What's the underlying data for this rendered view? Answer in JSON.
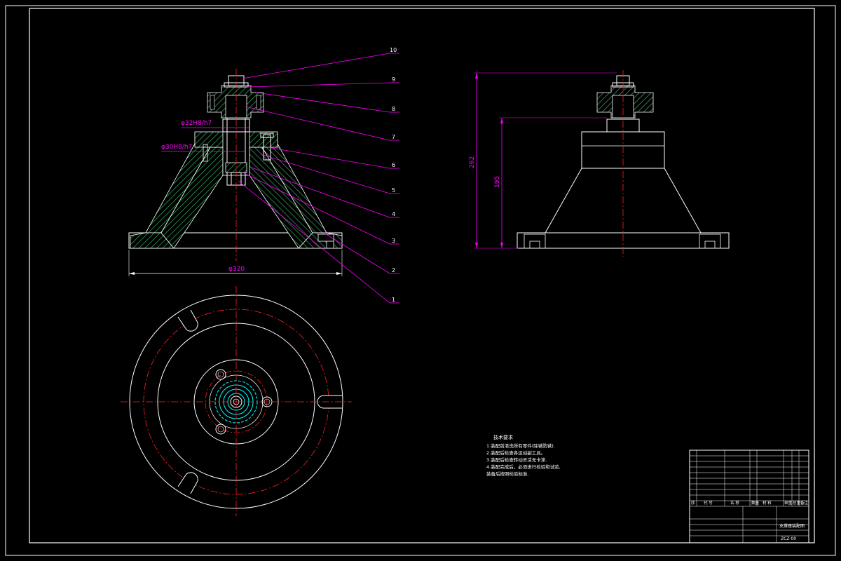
{
  "colors": {
    "background": "#000000",
    "line": "#ffffff",
    "hatch": "#2e8b57",
    "dimension": "#ff00ff",
    "centerline": "#ff2020",
    "cyan": "#00ffff",
    "label": "#ffffff"
  },
  "callouts": [
    "10",
    "9",
    "8",
    "7",
    "6",
    "5",
    "4",
    "3",
    "2",
    "1"
  ],
  "dimensions": {
    "fit_upper": "φ32H8/h7",
    "fit_lower": "φ30H8/h7",
    "base_diameter": "φ320",
    "overall_height": "262",
    "cone_height": "195"
  },
  "tech_notes": {
    "title": "技术要求",
    "lines": [
      "1.装配前清洗所有零件(除锈防锈).",
      "2.装配后检查各运动副工具。",
      "3.装配后检查转动灵活无卡滞.",
      "4.装配完成后，必须进行检验和试验,",
      "装备后按照检验标准."
    ]
  },
  "title_block": {
    "bom_headers": [
      "序",
      "代 号",
      "名 称",
      "数量",
      "材 料",
      "单重",
      "总重",
      "备注"
    ],
    "drawing_name": "支撑座装配图",
    "drawing_no": "ZCZ-00"
  }
}
